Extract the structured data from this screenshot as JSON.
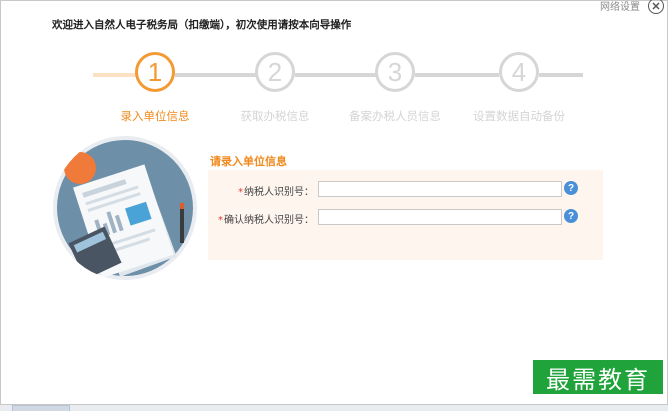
{
  "header": {
    "title": "欢迎进入自然人电子税务局（扣缴端），初次使用请按本向导操作",
    "net_settings": "网络设置",
    "close_icon": "close-icon"
  },
  "stepper": {
    "steps": [
      {
        "number": "1",
        "label": "录入单位信息",
        "active": true
      },
      {
        "number": "2",
        "label": "获取办税信息",
        "active": false
      },
      {
        "number": "3",
        "label": "备案办税人员信息",
        "active": false
      },
      {
        "number": "4",
        "label": "设置数据自动备份",
        "active": false
      }
    ],
    "colors": {
      "active": "#f39a35",
      "inactive": "#d6d6d6"
    }
  },
  "form": {
    "section_title": "请录入单位信息",
    "required_mark": "*",
    "fields": [
      {
        "label": "纳税人识别号：",
        "value": "",
        "help": "?"
      },
      {
        "label": "确认纳税人识别号：",
        "value": "",
        "help": "?"
      }
    ]
  },
  "watermark": {
    "text": "最需教育",
    "color": "#1fa33a"
  }
}
